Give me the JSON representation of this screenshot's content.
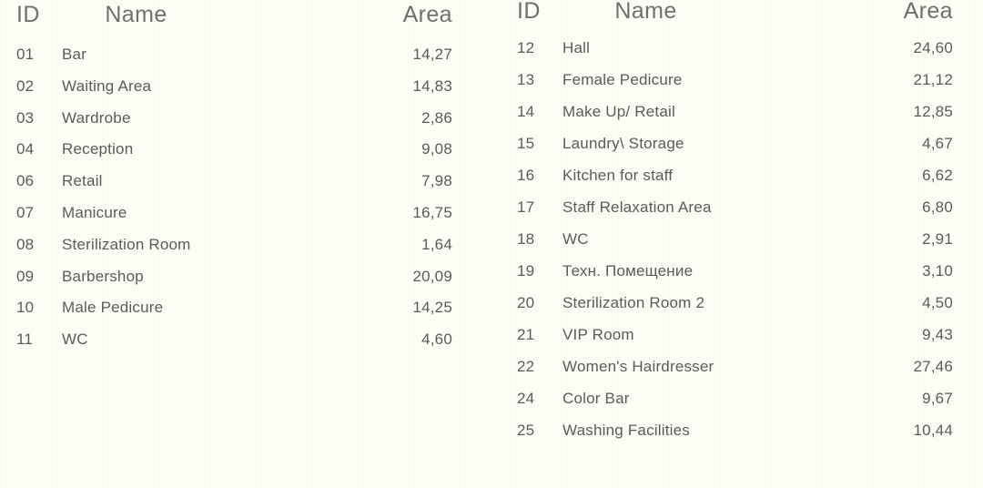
{
  "tables": [
    {
      "id": "left",
      "headers": {
        "id": "ID",
        "name": "Name",
        "area": "Area"
      },
      "rows": [
        {
          "id": "01",
          "name": "Bar",
          "area": "14,27"
        },
        {
          "id": "02",
          "name": "Waiting Area",
          "area": "14,83"
        },
        {
          "id": "03",
          "name": "Wardrobe",
          "area": "2,86"
        },
        {
          "id": "04",
          "name": "Reception",
          "area": "9,08"
        },
        {
          "id": "06",
          "name": "Retail",
          "area": "7,98"
        },
        {
          "id": "07",
          "name": "Manicure",
          "area": "16,75"
        },
        {
          "id": "08",
          "name": "Sterilization Room",
          "area": "1,64"
        },
        {
          "id": "09",
          "name": "Barbershop",
          "area": "20,09"
        },
        {
          "id": "10",
          "name": "Male Pedicure",
          "area": "14,25"
        },
        {
          "id": "11",
          "name": "WC",
          "area": "4,60"
        }
      ]
    },
    {
      "id": "right",
      "headers": {
        "id": "ID",
        "name": "Name",
        "area": "Area"
      },
      "rows": [
        {
          "id": "12",
          "name": "Hall",
          "area": "24,60"
        },
        {
          "id": "13",
          "name": "Female Pedicure",
          "area": "21,12"
        },
        {
          "id": "14",
          "name": "Make Up/ Retail",
          "area": "12,85"
        },
        {
          "id": "15",
          "name": "Laundry\\ Storage",
          "area": "4,67"
        },
        {
          "id": "16",
          "name": "Kitchen for staff",
          "area": "6,62"
        },
        {
          "id": "17",
          "name": "Staff Relaxation Area",
          "area": "6,80"
        },
        {
          "id": "18",
          "name": "WC",
          "area": "2,91"
        },
        {
          "id": "19",
          "name": "Техн. Помещение",
          "area": "3,10"
        },
        {
          "id": "20",
          "name": "Sterilization Room 2",
          "area": "4,50"
        },
        {
          "id": "21",
          "name": "VIP Room",
          "area": "9,43"
        },
        {
          "id": "22",
          "name": "Women's Hairdresser",
          "area": "27,46"
        },
        {
          "id": "24",
          "name": "Color Bar",
          "area": "9,67"
        },
        {
          "id": "25",
          "name": "Washing Facilities",
          "area": "10,44"
        }
      ]
    }
  ],
  "colors": {
    "background": "#fdfdf6",
    "header_text": "#6f6f6f",
    "body_text": "#5b5b5b"
  }
}
